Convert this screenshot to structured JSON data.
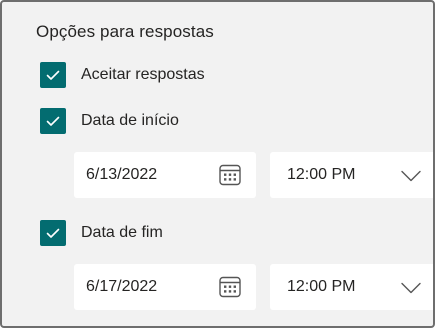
{
  "section": {
    "title": "Opções para respostas"
  },
  "accept": {
    "label": "Aceitar respostas",
    "checked": true
  },
  "start": {
    "label": "Data de início",
    "checked": true,
    "date": "6/13/2022",
    "time": "12:00 PM"
  },
  "end": {
    "label": "Data de fim",
    "checked": true,
    "date": "6/17/2022",
    "time": "12:00 PM"
  },
  "icons": {
    "check": "checkmark-icon",
    "calendar": "calendar-icon",
    "dropdown": "chevron-down-icon"
  },
  "colors": {
    "accent": "#036c70",
    "panel_bg": "#f2f2f2",
    "field_bg": "#ffffff",
    "text": "#252423"
  }
}
